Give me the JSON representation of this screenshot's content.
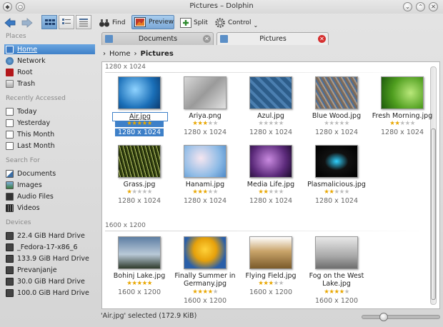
{
  "window": {
    "title": "Pictures – Dolphin"
  },
  "toolbar": {
    "find_label": "Find",
    "preview_label": "Preview",
    "split_label": "Split",
    "control_label": "Control"
  },
  "sidebar": {
    "places_header": "Places",
    "places": [
      {
        "label": "Home",
        "icon": "home-icon"
      },
      {
        "label": "Network",
        "icon": "network-icon"
      },
      {
        "label": "Root",
        "icon": "root-folder-icon"
      },
      {
        "label": "Trash",
        "icon": "trash-icon"
      }
    ],
    "recent_header": "Recently Accessed",
    "recent": [
      {
        "label": "Today"
      },
      {
        "label": "Yesterday"
      },
      {
        "label": "This Month"
      },
      {
        "label": "Last Month"
      }
    ],
    "search_header": "Search For",
    "search": [
      {
        "label": "Documents"
      },
      {
        "label": "Images"
      },
      {
        "label": "Audio Files"
      },
      {
        "label": "Videos"
      }
    ],
    "devices_header": "Devices",
    "devices": [
      {
        "label": "22.4 GiB Hard Drive"
      },
      {
        "label": "_Fedora-17-x86_6"
      },
      {
        "label": "133.9 GiB Hard Drive"
      },
      {
        "label": "Prevanjanje"
      },
      {
        "label": "30.0 GiB Hard Drive"
      },
      {
        "label": "100.0 GiB Hard Drive"
      }
    ]
  },
  "tabs": [
    {
      "label": "Documents"
    },
    {
      "label": "Pictures"
    }
  ],
  "breadcrumb": {
    "home": "Home",
    "current": "Pictures"
  },
  "groups": [
    {
      "header": "1280 x 1024",
      "files": [
        {
          "name": "Air.jpg",
          "rating": 5,
          "dims": "1280 x 1024",
          "selected": true
        },
        {
          "name": "Ariya.png",
          "rating": 3,
          "dims": "1280 x 1024"
        },
        {
          "name": "Azul.jpg",
          "rating": 0,
          "dims": "1280 x 1024"
        },
        {
          "name": "Blue Wood.jpg",
          "rating": 0,
          "dims": "1280 x 1024"
        },
        {
          "name": "Fresh Morning.jpg",
          "rating": 2,
          "dims": "1280 x 1024"
        },
        {
          "name": "Grass.jpg",
          "rating": 1,
          "dims": "1280 x 1024"
        },
        {
          "name": "Hanami.jpg",
          "rating": 3,
          "dims": "1280 x 1024"
        },
        {
          "name": "Media Life.jpg",
          "rating": 2,
          "dims": "1280 x 1024"
        },
        {
          "name": "Plasmalicious.jpg",
          "rating": 2,
          "dims": "1280 x 1024"
        }
      ]
    },
    {
      "header": "1600 x 1200",
      "files": [
        {
          "name": "Bohinj Lake.jpg",
          "rating": 5,
          "dims": "1600 x 1200"
        },
        {
          "name": "Finally Summer in Germany.jpg",
          "rating": 4,
          "dims": "1600 x 1200"
        },
        {
          "name": "Flying Field.jpg",
          "rating": 3,
          "dims": "1600 x 1200"
        },
        {
          "name": "Fog on the West Lake.jpg",
          "rating": 4,
          "dims": "1600 x 1200"
        }
      ]
    }
  ],
  "status": {
    "text": "'Air.jpg' selected (172.9 KiB)",
    "zoom_fraction": 0.24
  },
  "colors": {
    "selection": "#3e80c8",
    "star": "#e8a600"
  }
}
